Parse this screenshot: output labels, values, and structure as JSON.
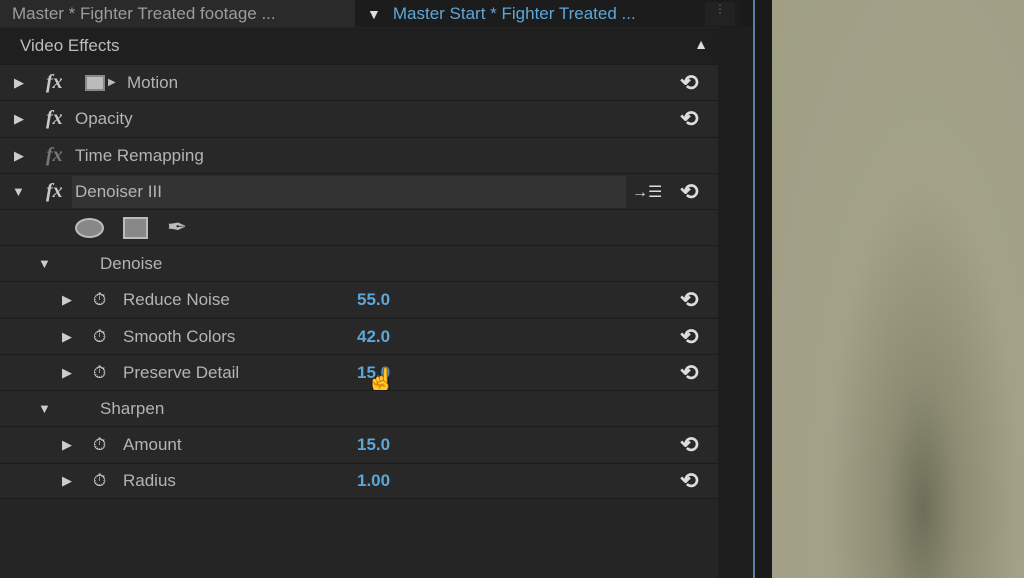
{
  "tabs": [
    {
      "label": "Master * Fighter Treated footage ..."
    },
    {
      "label": "Master Start * Fighter Treated ...",
      "active": true
    }
  ],
  "section_title": "Video Effects",
  "effects": [
    {
      "label": "Motion"
    },
    {
      "label": "Opacity"
    },
    {
      "label": "Time Remapping"
    },
    {
      "label": "Denoiser III"
    }
  ],
  "groups": [
    {
      "label": "Denoise",
      "params": [
        {
          "label": "Reduce Noise",
          "value": "55.0"
        },
        {
          "label": "Smooth Colors",
          "value": "42.0"
        },
        {
          "label": "Preserve Detail",
          "value": "15.0"
        }
      ]
    },
    {
      "label": "Sharpen",
      "params": [
        {
          "label": "Amount",
          "value": "15.0"
        },
        {
          "label": "Radius",
          "value": "1.00"
        }
      ]
    }
  ],
  "colors": {
    "value": "#5fa6d8",
    "panel": "#252525"
  }
}
